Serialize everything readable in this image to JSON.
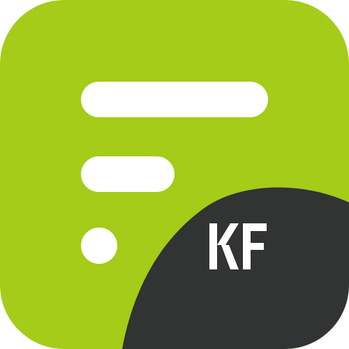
{
  "app_icon": {
    "monogram": "KF",
    "colors": {
      "background": "#a4cc19",
      "corner_blob": "#323333",
      "lines": "#ffffff",
      "monogram": "#ffffff"
    }
  }
}
